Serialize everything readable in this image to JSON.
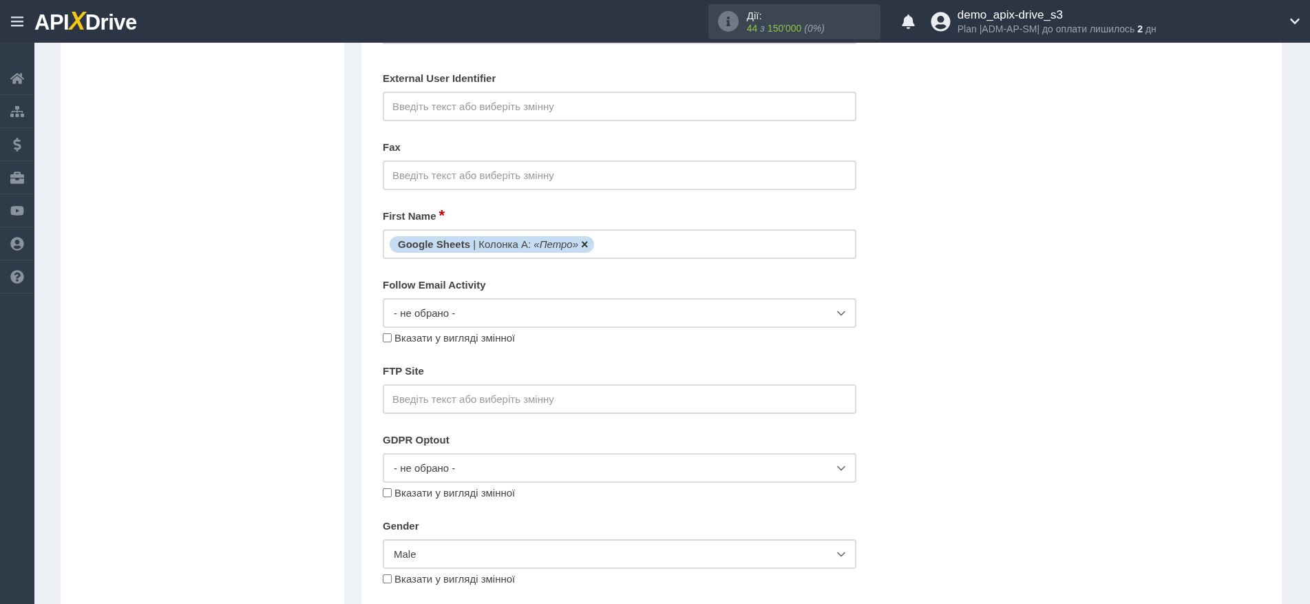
{
  "header": {
    "logo": {
      "left": "API",
      "mark": "X",
      "right": "Drive"
    },
    "actions": {
      "label": "Дії:",
      "used": "44",
      "of": "з",
      "total": "150'000",
      "percent": "(0%)"
    },
    "user": {
      "name": "demo_apix-drive_s3",
      "plan": "Plan |ADM-AP-SM| до оплати лишилось **2** дн"
    }
  },
  "sidebar": {
    "items": [
      {
        "selected": false
      },
      {
        "selected": false
      },
      {
        "selected": false
      },
      {
        "selected": false
      },
      {
        "selected": false
      },
      {
        "selected": false
      },
      {
        "selected": false
      }
    ]
  },
  "form": {
    "fields": [
      {
        "kind": "text",
        "label": "External User Identifier",
        "placeholder": "Введіть текст або виберіть змінну"
      },
      {
        "kind": "text",
        "label": "Fax",
        "placeholder": "Введіть текст або виберіть змінну"
      },
      {
        "kind": "tags",
        "label": "First Name",
        "required": "*",
        "tag": {
          "source": "Google Sheets",
          "column": " | Колонка A: ",
          "value": "«Петро»",
          "remove": "×"
        }
      },
      {
        "kind": "select",
        "label": "Follow Email Activity",
        "value": "- не обрано -",
        "variable": {
          "label": "Вказати у вигляді змінної",
          "checked": false
        }
      },
      {
        "kind": "text",
        "label": "FTP Site",
        "placeholder": "Введіть текст або виберіть змінну"
      },
      {
        "kind": "select",
        "label": "GDPR Optout",
        "value": "- не обрано -",
        "variable": {
          "label": "Вказати у вигляді змінної",
          "checked": false
        }
      },
      {
        "kind": "select",
        "label": "Gender",
        "value": "Male",
        "variable": {
          "label": "Вказати у вигляді змінної",
          "checked": false
        }
      }
    ]
  }
}
